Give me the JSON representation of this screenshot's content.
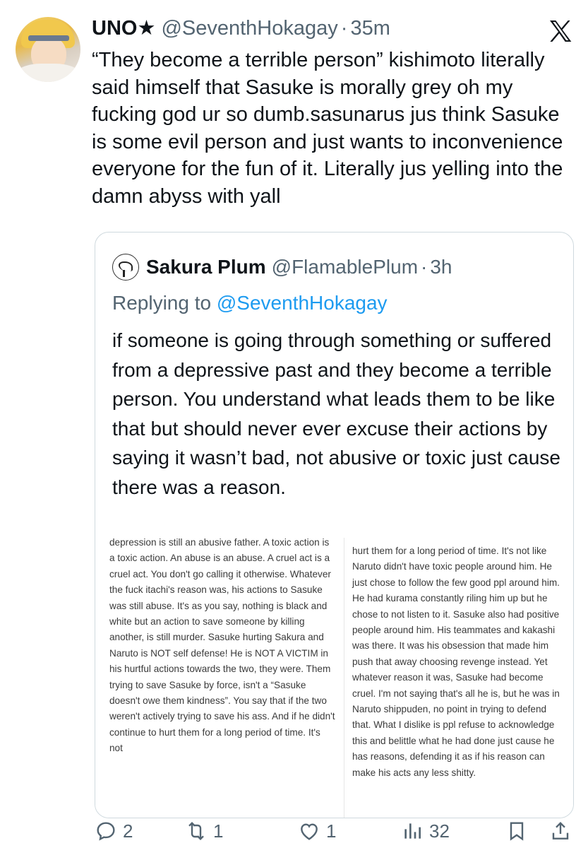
{
  "author": {
    "name": "UNO★",
    "handle": "@SeventhHokagay",
    "separator": "·",
    "time": "35m"
  },
  "tweet": {
    "text": "“They become a terrible person” kishimoto literally said himself that Sasuke is morally grey oh my fucking god ur so dumb.sasunarus jus think Sasuke is some evil person and just wants to inconvenience everyone for the fun of it. Literally jus yelling into the damn abyss with yall"
  },
  "quote": {
    "name": "Sakura Plum",
    "handle": "@FlamablePlum",
    "separator": "·",
    "time": "3h",
    "replying_prefix": "Replying to ",
    "replying_mention": "@SeventhHokagay",
    "text": "if someone is going through something or suffered from a depressive past and they become a terrible person. You understand what leads them to be like that but should never ever excuse their actions by saying it wasn’t bad, not abusive or toxic just cause there was a reason.",
    "image": {
      "left_text": "depression is still an abusive father. A toxic action is a toxic action. An abuse is an abuse. A cruel act is a cruel act. You don't go calling it otherwise. Whatever the fuck itachi's reason was, his actions to Sasuke was still abuse. It's as you say, nothing is black and white but an action to save someone by killing another, is still murder. Sasuke hurting Sakura and Naruto is NOT self defense! He is NOT A VICTIM in his hurtful actions towards the two, they were. Them trying to save Sasuke by force, isn't a “Sasuke doesn't owe them kindness”. You say that if the two weren't actively trying to save his ass. And if he didn't continue to hurt them for a long period of time. It's not",
      "right_text": "hurt them for a long period of time. It's not like Naruto didn't have toxic people around him. He just chose to follow the few good ppl around him. He had kurama constantly riling him up but he chose to not listen to it. Sasuke also had positive people around him. His teammates and kakashi was there. It was his obsession that made him push that away choosing revenge instead. Yet whatever reason it was, Sasuke had become cruel. I'm not saying that's all he is, but he was in Naruto shippuden, no point in trying to defend that. What I dislike is ppl refuse to acknowledge this and belittle what he had done just cause he has reasons, defending it as if his reason can make his acts any less shitty."
    }
  },
  "actions": {
    "replies": "2",
    "reposts": "1",
    "likes": "1",
    "views": "32"
  },
  "icons": [
    "x-logo-icon",
    "reply-icon",
    "repost-icon",
    "like-icon",
    "views-icon",
    "bookmark-icon",
    "share-icon"
  ],
  "colors": {
    "text": "#0f1419",
    "secondary": "#536471",
    "link": "#1d9bf0",
    "border": "#cfd9de"
  }
}
